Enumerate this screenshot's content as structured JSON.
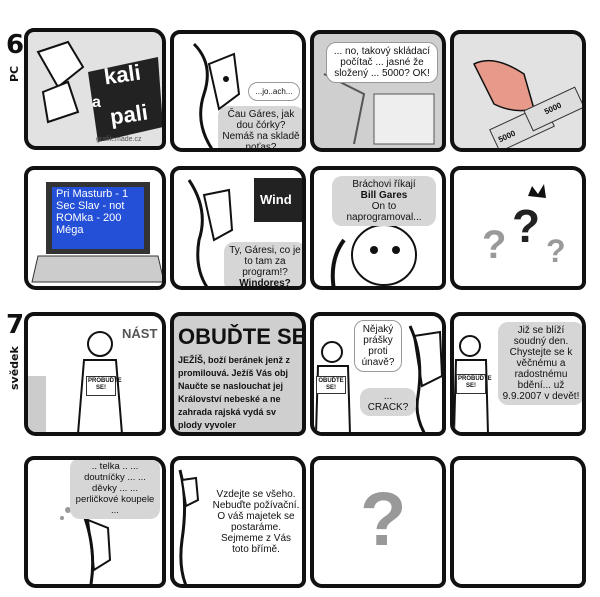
{
  "sections": {
    "row1_number": "6",
    "row1_label": "PC",
    "row3_number": "7",
    "row3_label": "svědek"
  },
  "title_panel": {
    "logo_line1": "kali",
    "logo_line2": "a",
    "logo_line3": "pali",
    "credit": "grafik.made.cz"
  },
  "panels": {
    "p2_small": "...jo..ach...",
    "p2_bubble": "Čau Gáres, jak dou čórky? Nemáš na skladě noťas?",
    "p3_bubble": "... no, takový skládací počítač ... jasné že složený ... 5000? OK!",
    "p4_note1": "5000",
    "p4_note2": "5000",
    "p5_screen": "Pri Masturb - 1 Sec Slav - not ROMka - 200 Méga",
    "p6_window": "Wind",
    "p6_bubble_line1": "Ty, Gáresi, co je to tam za program!?",
    "p6_bubble_line2": "Windores?",
    "p7_bubble_line1": "Bráchovi říkají",
    "p7_bubble_line2": "Bill Gares",
    "p7_bubble_line3": "On to naprogramoval...",
    "p9_sign_top": "NÁST",
    "p9_sign_body": "PROBUĎTE SE!",
    "p10_headline": "OBUĎTE SE",
    "p10_lines": [
      "JEŽÍŠ, boží beránek jenž z",
      "promilouvá. Ježíš Vás obj",
      "Naučte se naslouchat jej",
      "Království nebeské a ne",
      "zahrada rajská vydá sv",
      "plody vyvoler"
    ],
    "p11_bubble1": "Nějaký prášky proti únavě?",
    "p11_bubble2": "... CRACK?",
    "p11_sign": "OBUĎTE SE!",
    "p12_sign": "PROBUĎTE SE!",
    "p12_bubble": "Již se blíží soudný den. Chystejte se k věčnému a radostnému bdění... už 9.9.2007 v devět!",
    "p13_bubble": ".. telka .. ... doutníčky ... ... děvky ... ... perličkové koupele ...",
    "p14_bubble": "Vzdejte se všeho. Nebuďte požívační. O váš majetek se postaráme. Sejmeme z Vás toto břímě.",
    "p15_mark": "?"
  }
}
